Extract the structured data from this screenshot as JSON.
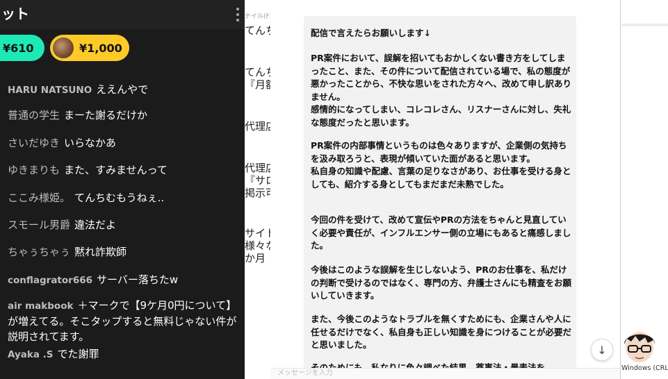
{
  "chat": {
    "title": "ット",
    "donations": [
      {
        "amount": "¥610",
        "color": "#1de9b6"
      },
      {
        "amount": "¥1,000",
        "color": "#ffca28"
      }
    ],
    "messages": [
      {
        "author": "HARU NATSUNO",
        "text": "ええんやで"
      },
      {
        "author": "普通の学生",
        "text": "まーた謝るだけか"
      },
      {
        "author": "さいだゆき",
        "text": "いらなかあ"
      },
      {
        "author": "ゆきまりも",
        "text": "また、すみませんって"
      },
      {
        "author": "ここみ様姫。",
        "text": "てんちむもうねぇ.."
      },
      {
        "author": "スモール男爵",
        "text": "違法だよ"
      },
      {
        "author": "ちゃぅちゃぅ",
        "text": "黙れ詐欺師"
      },
      {
        "author": "conflagrator666",
        "text": "サーバー落ちたw"
      },
      {
        "author": "air makbook",
        "text": "＋マークで【9ケ月0円について】が増えてる。そこタップすると無料じゃない件が説明されてます。"
      },
      {
        "author": "Ayaka .S",
        "text": "でた謝罪"
      }
    ]
  },
  "middle": {
    "small_label": "ナイル(F)",
    "lines": [
      "てんち",
      "てんち",
      "『月額",
      "代理店",
      "代理店",
      "『サロ",
      "掲示可",
      "サイト",
      "様々な",
      "か月"
    ]
  },
  "document": {
    "paragraphs": [
      "配信で言えたらお願いします↓",
      "PR案件において、誤解を招いてもおかしくない書き方をしてしまったこと、また、その件について配信されている場で、私の態度が悪かったことから、不快な思いをされた方々へ、改めて申し訳ありません。\n感情的になってしまい、コレコレさん、リスナーさんに対し、失礼な態度だったと思います。",
      "PR案件の内部事情というものは色々ありますが、企業側の気持ちを汲み取ろうと、表現が傾いていた面があると思います。\n私自身の知識や配慮、言葉の足りなさがあり、お仕事を受ける身としても、紹介する身としてもまだまだ未熟でした。",
      "今回の件を受けて、改めて宣伝やPRの方法をちゃんと見直していく必要や責任が、インフルエンサー側の立場にもあると痛感しました。",
      "今後はこのような誤解を生じしないよう、PRのお仕事を、私だけの判断で受けるのではなく、専門の方、弁護士さんにも精査をお願いしていきます。",
      "また、今後このようなトラブルを無くすためにも、企業さんや人に任せるだけでなく、私自身も正しい知識を身につけることが必要だと思いました。",
      "そのためにも、私なりに色々調べた結果、薬事法・景表法を"
    ],
    "input_placeholder": "メッセージを入力"
  },
  "far_right": {
    "status": "Windows (CRLF)"
  },
  "icons": {
    "kebab": "kebab-menu-icon",
    "scroll_down": "arrow-down-icon"
  }
}
